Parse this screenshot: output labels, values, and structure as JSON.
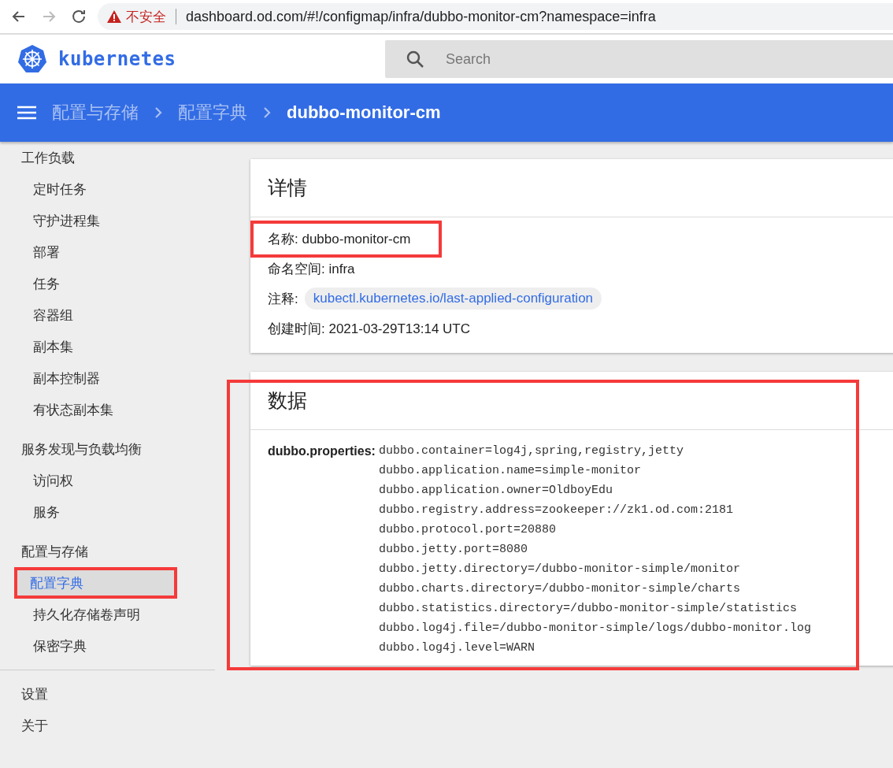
{
  "browser": {
    "back_disabled": false,
    "forward_disabled": true,
    "security_label": "不安全",
    "url": "dashboard.od.com/#!/configmap/infra/dubbo-monitor-cm?namespace=infra"
  },
  "header": {
    "logo_text": "kubernetes",
    "search": {
      "placeholder": "Search"
    }
  },
  "breadcrumb": [
    {
      "label": "配置与存储",
      "current": false
    },
    {
      "label": "配置字典",
      "current": false
    },
    {
      "label": "dubbo-monitor-cm",
      "current": true
    }
  ],
  "sidebar": {
    "items": [
      {
        "label": "工作负载",
        "selected": false,
        "highlighted": false,
        "children": [
          {
            "label": "定时任务",
            "selected": false,
            "highlighted": false
          },
          {
            "label": "守护进程集",
            "selected": false,
            "highlighted": false
          },
          {
            "label": "部署",
            "selected": false,
            "highlighted": false
          },
          {
            "label": "任务",
            "selected": false,
            "highlighted": false
          },
          {
            "label": "容器组",
            "selected": false,
            "highlighted": false
          },
          {
            "label": "副本集",
            "selected": false,
            "highlighted": false
          },
          {
            "label": "副本控制器",
            "selected": false,
            "highlighted": false
          },
          {
            "label": "有状态副本集",
            "selected": false,
            "highlighted": false
          }
        ]
      },
      {
        "label": "服务发现与负载均衡",
        "selected": false,
        "highlighted": false,
        "children": [
          {
            "label": "访问权",
            "selected": false,
            "highlighted": false
          },
          {
            "label": "服务",
            "selected": false,
            "highlighted": false
          }
        ]
      },
      {
        "label": "配置与存储",
        "selected": false,
        "highlighted": false,
        "children": [
          {
            "label": "配置字典",
            "selected": true,
            "highlighted": true
          },
          {
            "label": "持久化存储卷声明",
            "selected": false,
            "highlighted": false
          },
          {
            "label": "保密字典",
            "selected": false,
            "highlighted": false
          }
        ]
      },
      {
        "label": "设置",
        "selected": false,
        "highlighted": false,
        "divider_before": true
      },
      {
        "label": "关于",
        "selected": false,
        "highlighted": false
      }
    ]
  },
  "details": {
    "title": "详情",
    "fields": [
      {
        "kind": "text",
        "text": "名称: dubbo-monitor-cm",
        "highlighted": true
      },
      {
        "kind": "text",
        "text": "命名空间: infra",
        "highlighted": false
      },
      {
        "kind": "chips",
        "label": "注释:",
        "chips": [
          "kubectl.kubernetes.io/last-applied-configuration"
        ]
      },
      {
        "kind": "text",
        "text": "创建时间: 2021-03-29T13:14 UTC",
        "highlighted": false
      }
    ]
  },
  "data": {
    "title": "数据",
    "highlighted": true,
    "entries": [
      {
        "key": "dubbo.properties:",
        "lines": [
          "dubbo.container=log4j,spring,registry,jetty",
          "dubbo.application.name=simple-monitor",
          "dubbo.application.owner=OldboyEdu",
          "dubbo.registry.address=zookeeper://zk1.od.com:2181",
          "dubbo.protocol.port=20880",
          "dubbo.jetty.port=8080",
          "dubbo.jetty.directory=/dubbo-monitor-simple/monitor",
          "dubbo.charts.directory=/dubbo-monitor-simple/charts",
          "dubbo.statistics.directory=/dubbo-monitor-simple/statistics",
          "dubbo.log4j.file=/dubbo-monitor-simple/logs/dubbo-monitor.log",
          "dubbo.log4j.level=WARN"
        ]
      }
    ]
  }
}
